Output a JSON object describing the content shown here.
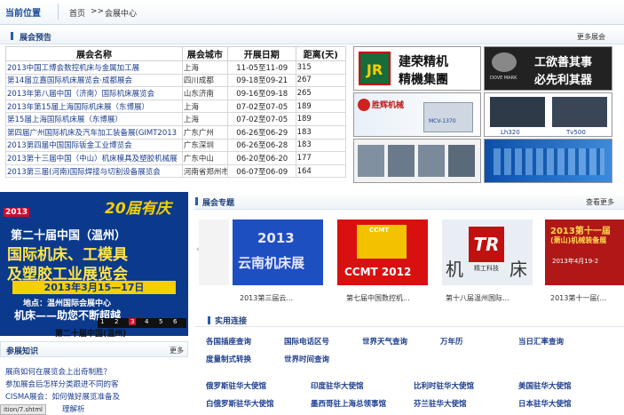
{
  "breadcrumb": {
    "current_label": "当前位置",
    "home": "首页",
    "arrow": ">>",
    "page": "会展中心"
  },
  "preview": {
    "title": "展会预告",
    "more": "更多展会",
    "headers": [
      "展会名称",
      "展会城市",
      "开展日期",
      "距离(天)"
    ],
    "rows": [
      {
        "name": "2013中国工博会数控机床与金属加工展",
        "city": "上海",
        "date": "11-05至11-09",
        "days": "315"
      },
      {
        "name": "第14届立嘉国际机床展览会·成都展会",
        "city": "四川成都",
        "date": "09-18至09-21",
        "days": "267"
      },
      {
        "name": "2013年第八届中国（济南）国际机床展览会",
        "city": "山东济南",
        "date": "09-16至09-18",
        "days": "265"
      },
      {
        "name": "2013年第15届上海国际机床展（东博展）",
        "city": "上海",
        "date": "07-02至07-05",
        "days": "189"
      },
      {
        "name": "第15届上海国际机床展（东博展）",
        "city": "上海",
        "date": "07-02至07-05",
        "days": "189"
      },
      {
        "name": "第四届广州国际机床及汽车加工装备展(GIMT2013",
        "city": "广东广州",
        "date": "06-26至06-29",
        "days": "183"
      },
      {
        "name": "2013第四届中国国际钣金工业博览会",
        "city": "广东深圳",
        "date": "06-26至06-28",
        "days": "183"
      },
      {
        "name": "2013第十三届中国（中山）机床模具及塑胶机械展",
        "city": "广东中山",
        "date": "06-20至06-20",
        "days": "177"
      },
      {
        "name": "2013第三届(河南)国际焊接与切割设备展览会",
        "city": "河南省郑州市",
        "date": "06-07至06-09",
        "days": "164"
      }
    ]
  },
  "logos": {
    "jr_name1": "建荣精机",
    "jr_name2": "精機集團",
    "dove_text1": "工欲善其事",
    "dove_text2": "必先利其器",
    "dove_brand": "DOVE MARK",
    "shenghui": "胜辉机械",
    "mcv": "MCV-1370",
    "lh": "Lh320",
    "tv": "Tv500"
  },
  "banner": {
    "year_logo": "2013",
    "anniv": "20届有庆",
    "line1": "第二十届中国（温州）",
    "line2": "国际机床、工模具",
    "line3": "及塑胶工业展览会",
    "dates": "2013年3月15—17日",
    "venue": "地点：温州国际会展中心",
    "slogan": "机床——助您不断超越",
    "pages": [
      "1",
      "2",
      "3",
      "4",
      "5",
      "6"
    ],
    "caption": "第二十届中国(温州)"
  },
  "special": {
    "title": "展会专题",
    "more": "查看更多",
    "items": [
      {
        "caption": "2013第三届云..."
      },
      {
        "caption": "第七届中国数控机..."
      },
      {
        "caption": "第十八届温州国际..."
      },
      {
        "caption": "2013第十一届(..."
      }
    ],
    "img_texts": {
      "yunnan1": "2013",
      "yunnan2": "云南机床展",
      "ccmt": "CCMT 2012",
      "ccmt_small": "CCMT",
      "wz_left": "机",
      "wz_right": "床",
      "wz_logo": "TR",
      "wz_sub": "精工科技",
      "xs1": "2013第十一届",
      "xs2": "(萧山)机械装备展",
      "xs3": "2013年4月19-2"
    }
  },
  "links": {
    "title": "实用连接",
    "row1": [
      "各国插座查询",
      "国际电话区号",
      "世界天气查询",
      "万年历",
      "当日汇率查询"
    ],
    "row2": [
      "度量制式转换",
      "世界时间查询"
    ],
    "row3": [
      "俄罗斯驻华大使馆",
      "印度驻华大使馆",
      "比利时驻华大使馆",
      "美国驻华大使馆"
    ],
    "row4": [
      "白俄罗斯驻华大使馆",
      "墨西哥驻上海总领事馆",
      "芬兰驻华大使馆",
      "日本驻华大使馆"
    ]
  },
  "knowledge": {
    "title": "参展知识",
    "more": "更多",
    "items": [
      "展商如何在展览会上出奇制胜？",
      "参加展会后怎样分类跟进不同的客",
      "CISMA展会：如何做好展览准备及",
      "理解析"
    ],
    "status": "ition/7.shtml"
  }
}
